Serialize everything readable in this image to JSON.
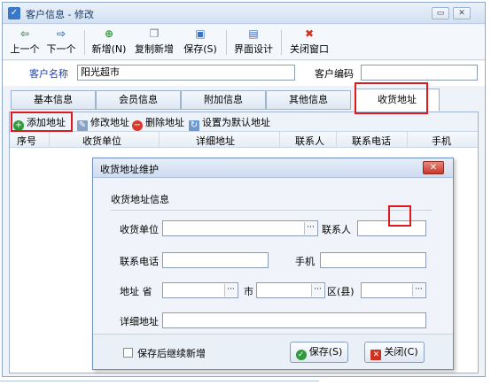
{
  "window": {
    "title": "客户信息 - 修改",
    "title_icon": "checkbox-icon"
  },
  "toolbar": {
    "items": [
      {
        "label": "上一个",
        "icon": "arrow-left-icon",
        "glyph": "⇦",
        "color": "#2f8f3a"
      },
      {
        "label": "下一个",
        "icon": "arrow-right-icon",
        "glyph": "⇨",
        "color": "#2d6fc4"
      },
      {
        "label": "新增(N)",
        "icon": "add-icon",
        "glyph": "⊕",
        "color": "#2f9a3a"
      },
      {
        "label": "复制新增",
        "icon": "copy-icon",
        "glyph": "❐",
        "color": "#6c7a8e"
      },
      {
        "label": "保存(S)",
        "icon": "save-icon",
        "glyph": "▣",
        "color": "#3a72c4"
      },
      {
        "label": "界面设计",
        "icon": "layout-icon",
        "glyph": "▤",
        "color": "#3a72c4"
      },
      {
        "label": "关闭窗口",
        "icon": "close-window-icon",
        "glyph": "✖",
        "color": "#d0301f"
      }
    ]
  },
  "customer": {
    "name_label": "客户名称",
    "name_value": "阳光超市",
    "code_label": "客户编码",
    "code_value": ""
  },
  "tabs": [
    {
      "label": "基本信息",
      "active": false
    },
    {
      "label": "会员信息",
      "active": false
    },
    {
      "label": "附加信息",
      "active": false
    },
    {
      "label": "其他信息",
      "active": false
    },
    {
      "label": "收货地址",
      "active": true
    }
  ],
  "address_toolbar": {
    "add": "添加地址",
    "edit": "修改地址",
    "delete": "删除地址",
    "set_default": "设置为默认地址"
  },
  "grid": {
    "columns": [
      "序号",
      "收货单位",
      "详细地址",
      "联系人",
      "联系电话",
      "手机"
    ]
  },
  "dialog": {
    "title": "收货地址维护",
    "section": "收货地址信息",
    "fields": {
      "unit_label": "收货单位",
      "unit_value": "",
      "contact_label": "联系人",
      "contact_value": "",
      "phone_label": "联系电话",
      "phone_value": "",
      "mobile_label": "手机",
      "mobile_value": "",
      "province_label": "地址 省",
      "city_label": "市",
      "district_label": "区(县)",
      "detail_label": "详细地址",
      "detail_value": ""
    },
    "ellipsis": "···",
    "continue_label": "保存后继续新增",
    "save_button": "保存(S)",
    "close_button": "关闭(C)"
  },
  "colors": {
    "highlight": "#e0191e",
    "label_blue": "#1a3fb5"
  }
}
